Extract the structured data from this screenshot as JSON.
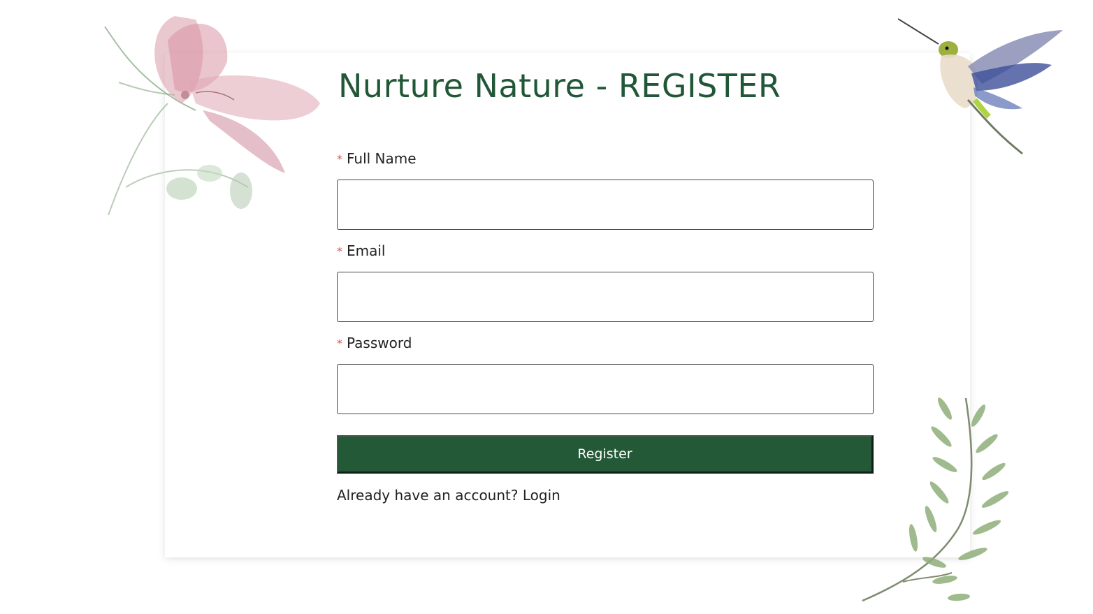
{
  "colors": {
    "title": "#215737",
    "button": "#235936",
    "required": "#d9534f"
  },
  "page": {
    "title": "Nurture Nature - REGISTER"
  },
  "form": {
    "fields": [
      {
        "label": "Full Name",
        "required_mark": "*",
        "value": "",
        "placeholder": ""
      },
      {
        "label": "Email",
        "required_mark": "*",
        "value": "",
        "placeholder": ""
      },
      {
        "label": "Password",
        "required_mark": "*",
        "value": "",
        "placeholder": ""
      }
    ],
    "submit_label": "Register"
  },
  "footer": {
    "prompt": "Already have an account?",
    "login_label": "Login"
  },
  "decorations": {
    "flower": "watercolor-flower-icon",
    "hummingbird": "hummingbird-icon",
    "leaves": "leaf-branch-icon"
  }
}
